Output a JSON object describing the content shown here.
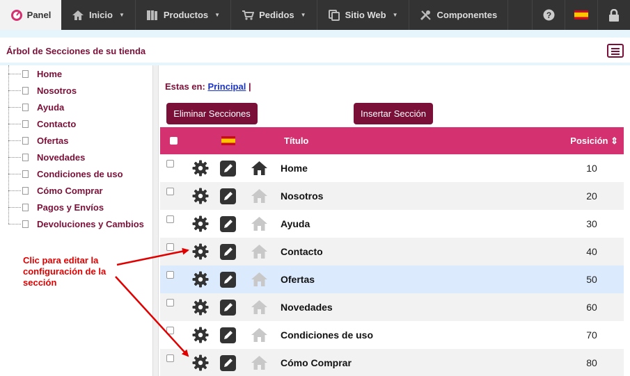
{
  "topnav": {
    "panel_label": "Panel",
    "items": [
      {
        "label": "Inicio",
        "icon": "home-icon"
      },
      {
        "label": "Productos",
        "icon": "catalog-icon"
      },
      {
        "label": "Pedidos",
        "icon": "cart-icon"
      },
      {
        "label": "Sitio Web",
        "icon": "copy-icon"
      },
      {
        "label": "Componentes",
        "icon": "tools-icon"
      }
    ],
    "right_icons": [
      "help-icon",
      "spanish-flag-icon",
      "lock-icon"
    ]
  },
  "page": {
    "title": "Árbol de Secciones de su tienda"
  },
  "tree": {
    "items": [
      "Home",
      "Nosotros",
      "Ayuda",
      "Contacto",
      "Ofertas",
      "Novedades",
      "Condiciones de uso",
      "Cómo Comprar",
      "Pagos y Envíos",
      "Devoluciones y Cambios"
    ]
  },
  "breadcrumb": {
    "prefix": "Estas en:",
    "link": "Principal",
    "separator": "|"
  },
  "actions": {
    "delete_label": "Eliminar Secciones",
    "insert_label": "Insertar Sección"
  },
  "table": {
    "col_title": "Título",
    "col_position": "Posición",
    "rows": [
      {
        "title": "Home",
        "position": "10",
        "is_home": true
      },
      {
        "title": "Nosotros",
        "position": "20",
        "is_home": false
      },
      {
        "title": "Ayuda",
        "position": "30",
        "is_home": false
      },
      {
        "title": "Contacto",
        "position": "40",
        "is_home": false
      },
      {
        "title": "Ofertas",
        "position": "50",
        "is_home": false
      },
      {
        "title": "Novedades",
        "position": "60",
        "is_home": false
      },
      {
        "title": "Condiciones de uso",
        "position": "70",
        "is_home": false
      },
      {
        "title": "Cómo Comprar",
        "position": "80",
        "is_home": false
      }
    ]
  },
  "annotation": {
    "text": "Clic para editar la configuración de la sección"
  },
  "colors": {
    "brand": "#7a0f38",
    "header": "#d33170",
    "annotation": "#e00000"
  }
}
